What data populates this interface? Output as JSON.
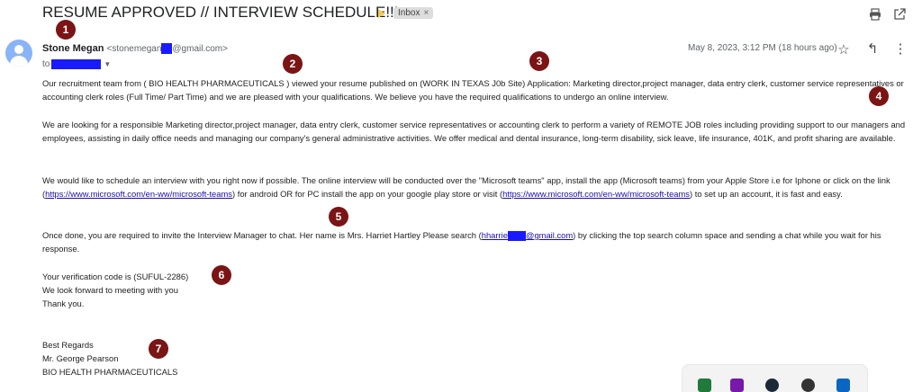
{
  "email": {
    "subject": "RESUME APPROVED // INTERVIEW SCHEDULE!!!",
    "label_inbox": "Inbox",
    "label_close": "×",
    "sender_name": "Stone Megan",
    "sender_email_prefix": "<stonemegan",
    "sender_email_suffix": "@gmail.com>",
    "to_label": "to",
    "date": "May 8, 2023, 3:12 PM (18 hours ago)",
    "paragraphs": {
      "p1": "Our recruitment team from ( BIO HEALTH PHARMACEUTICALS ) viewed your resume published on (WORK IN TEXAS J0b Site) Application: Marketing director,project manager, data entry clerk, customer service representatives or accounting clerk roles (Full Time/ Part Time) and we are pleased with your qualifications. We believe you have the required qualifications to undergo an online interview.",
      "p2": "We are looking for a responsible   Marketing director,project manager, data entry clerk, customer service representatives or accounting clerk to perform a variety of REMOTE JOB roles including providing support to our managers and employees, assisting in daily office needs and managing our company's general administrative activities. We offer medical and dental insurance, long-term disability, sick leave, life insurance, 401K, and profit sharing are available.",
      "p3a": "We would like to schedule an interview with you right now if possible. The online interview will be conducted over the \"Microsoft teams\" app, install the app (Microsoft teams) from your Apple Store i.e for Iphone or click on the link (",
      "p3_link1": "https://www.microsoft.com/en-ww/microsoft-teams",
      "p3b": ") for android OR for PC install the app on your google play store or visit  (",
      "p3_link2": "https://www.microsoft.com/en-ww/microsoft-teams",
      "p3c": ") to set up an account, it is fast and easy.",
      "p4a": "Once done, you are required to invite the Interview Manager to chat. Her name is Mrs. Harriet Hartley Please search (",
      "p4_link_prefix": "hharrie",
      "p4_link_suffix": "@gmail.com",
      "p4b": ") by clicking the top search column space and sending a chat while you wait for his response.",
      "p5_line1": "Your verification code is (SUFUL-2286)",
      "p5_line2": "We look forward to meeting with you",
      "p5_line3": "Thank you.",
      "sig_line1": "Best Regards",
      "sig_line2": "Mr. George Pearson",
      "sig_line3": "BIO HEALTH PHARMACEUTICALS"
    }
  },
  "icons": {
    "print": "print-icon",
    "open_new": "open-in-new-icon",
    "star": "☆",
    "reply": "↰",
    "more": "⋮"
  },
  "annotations": [
    "1",
    "2",
    "3",
    "4",
    "5",
    "6",
    "7"
  ],
  "colors": {
    "annotation": "#7b1414",
    "redaction": "#1a1aff",
    "link": "#1a0dab",
    "avatar": "#8ab4f8"
  }
}
